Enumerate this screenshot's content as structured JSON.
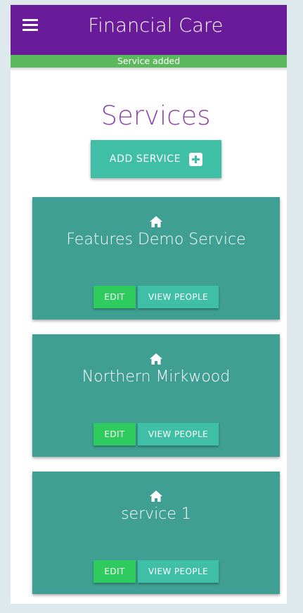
{
  "header": {
    "title": "Financial Care",
    "menu_icon": "hamburger-menu-icon"
  },
  "toast": {
    "message": "Service added",
    "color": "#5cb85c"
  },
  "page": {
    "title": "Services",
    "add_button_label": "ADD SERVICE",
    "add_button_icon": "plus-square-icon"
  },
  "services": [
    {
      "name": "Features Demo Service",
      "icon": "home-icon",
      "edit_label": "EDIT",
      "people_label": "VIEW PEOPLE"
    },
    {
      "name": "Northern Mirkwood",
      "icon": "home-icon",
      "edit_label": "EDIT",
      "people_label": "VIEW PEOPLE"
    },
    {
      "name": "service 1",
      "icon": "home-icon",
      "edit_label": "EDIT",
      "people_label": "VIEW PEOPLE"
    }
  ],
  "colors": {
    "header": "#6a1b9a",
    "title": "#8e44ad",
    "card": "#3f9f93",
    "accent_button": "#3fbfa6",
    "edit_button": "#2ecc5f"
  }
}
